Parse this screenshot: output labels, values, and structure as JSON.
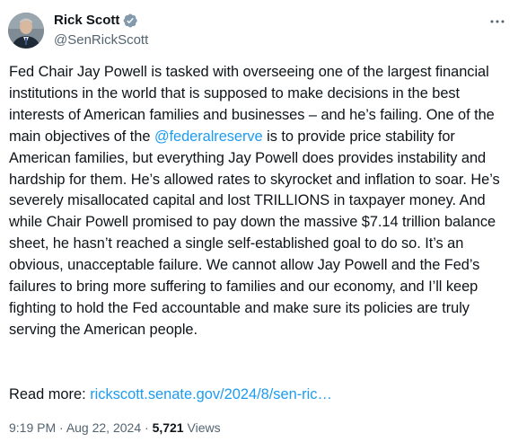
{
  "author": {
    "display_name": "Rick Scott",
    "handle": "@SenRickScott",
    "verified": true,
    "verified_badge_color": "#829aab"
  },
  "tweet": {
    "text_before_mention": "Fed Chair Jay Powell is tasked with overseeing one of the largest financial institutions in the world that is supposed to make decisions in the best interests of American families and businesses – and he’s failing. One of the main objectives of the ",
    "mention": "@federalreserve",
    "text_after_mention": " is to provide price stability for American families, but everything Jay Powell does provides instability and hardship for them. He’s allowed rates to skyrocket and inflation to soar. He’s severely misallocated capital and lost TRILLIONS in taxpayer money. And while Chair Powell promised to pay down the massive $7.14 trillion balance sheet, he hasn’t reached a single self-established goal to do so. It’s an obvious, unacceptable failure. We cannot allow Jay Powell and the Fed’s failures to bring more suffering to families and our economy, and I’ll keep fighting to hold the Fed accountable and make sure its policies are truly serving the American people.",
    "read_more_label": "Read more: ",
    "read_more_link": "rickscott.senate.gov/2024/8/sen-ric…"
  },
  "meta": {
    "time": "9:19 PM",
    "separator": " · ",
    "date": "Aug 22, 2024",
    "views_count": "5,721",
    "views_label": " Views"
  },
  "icons": {
    "more": "more-horizontal-icon",
    "verified": "verified-badge-icon"
  },
  "colors": {
    "link": "#1d9bf0",
    "text": "#0f1419",
    "secondary": "#536471"
  }
}
